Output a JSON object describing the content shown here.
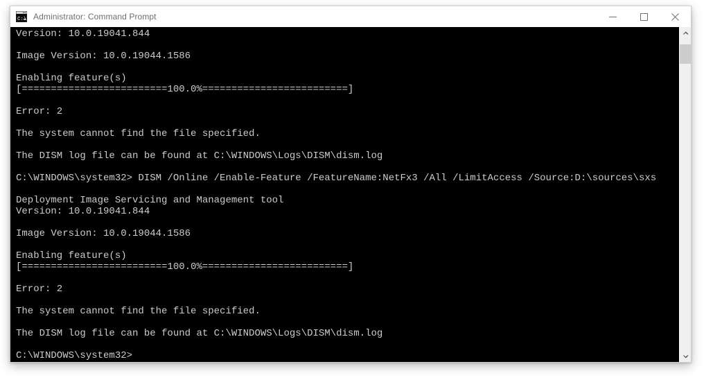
{
  "window": {
    "title": "Administrator: Command Prompt",
    "icon": "console-window-icon",
    "controls": [
      {
        "name": "minimize-button",
        "glyph": "minimize-icon",
        "label": "Minimize"
      },
      {
        "name": "maximize-button",
        "glyph": "maximize-icon",
        "label": "Maximize"
      },
      {
        "name": "close-button",
        "glyph": "close-icon",
        "label": "Close"
      }
    ],
    "colors": {
      "titlebar_background": "#ffffff",
      "title_text": "#6e6e6e",
      "console_background": "#000000",
      "console_text": "#cccccc",
      "window_border": "#cfcfcf",
      "scrollbar_track": "#f0f0f0",
      "scrollbar_thumb": "#cdcdcd"
    }
  },
  "scrollbar": {
    "up_arrow_label": "Scroll up",
    "down_arrow_label": "Scroll down",
    "thumb_label": "Scroll thumb"
  },
  "console": {
    "prompt": "C:\\WINDOWS\\system32>",
    "lines": [
      "Version: 10.0.19041.844",
      "",
      "Image Version: 10.0.19044.1586",
      "",
      "Enabling feature(s)",
      "[=========================100.0%=========================]",
      "",
      "Error: 2",
      "",
      "The system cannot find the file specified.",
      "",
      "The DISM log file can be found at C:\\WINDOWS\\Logs\\DISM\\dism.log",
      "",
      "C:\\WINDOWS\\system32> DISM /Online /Enable-Feature /FeatureName:NetFx3 /All /LimitAccess /Source:D:\\sources\\sxs",
      "",
      "Deployment Image Servicing and Management tool",
      "Version: 10.0.19041.844",
      "",
      "Image Version: 10.0.19044.1586",
      "",
      "Enabling feature(s)",
      "[=========================100.0%=========================]",
      "",
      "Error: 2",
      "",
      "The system cannot find the file specified.",
      "",
      "The DISM log file can be found at C:\\WINDOWS\\Logs\\DISM\\dism.log",
      "",
      "C:\\WINDOWS\\system32>"
    ]
  }
}
